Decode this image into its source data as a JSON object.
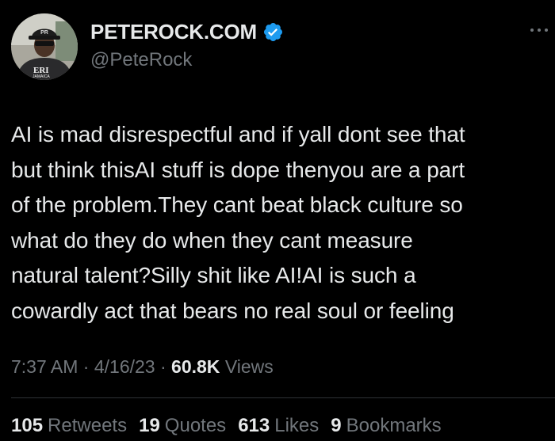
{
  "author": {
    "display_name": "PETEROCK.COM",
    "handle": "@PeteRock",
    "verified_color": "#1d9bf0",
    "avatar_hat_text": "PR",
    "avatar_shirt_text": "ERI",
    "avatar_shirt_subtext": "JAMAICA"
  },
  "tweet": {
    "text": "AI is mad disrespectful and if yall dont see that\nbut think thisAI stuff is dope thenyou are a part\nof the problem.They cant beat black culture so\nwhat do they do when they cant measure\nnatural talent?Silly shit like AI!AI is such a\ncowardly act that bears no real soul or feeling"
  },
  "meta": {
    "time": "7:37 AM",
    "separator": " · ",
    "date": "4/16/23",
    "views_count": "60.8K",
    "views_label": "Views"
  },
  "stats": [
    {
      "count": "105",
      "label": "Retweets"
    },
    {
      "count": "19",
      "label": "Quotes"
    },
    {
      "count": "613",
      "label": "Likes"
    },
    {
      "count": "9",
      "label": "Bookmarks"
    }
  ],
  "icons": {
    "verified": "verified-badge-icon",
    "more": "more-options-icon"
  }
}
